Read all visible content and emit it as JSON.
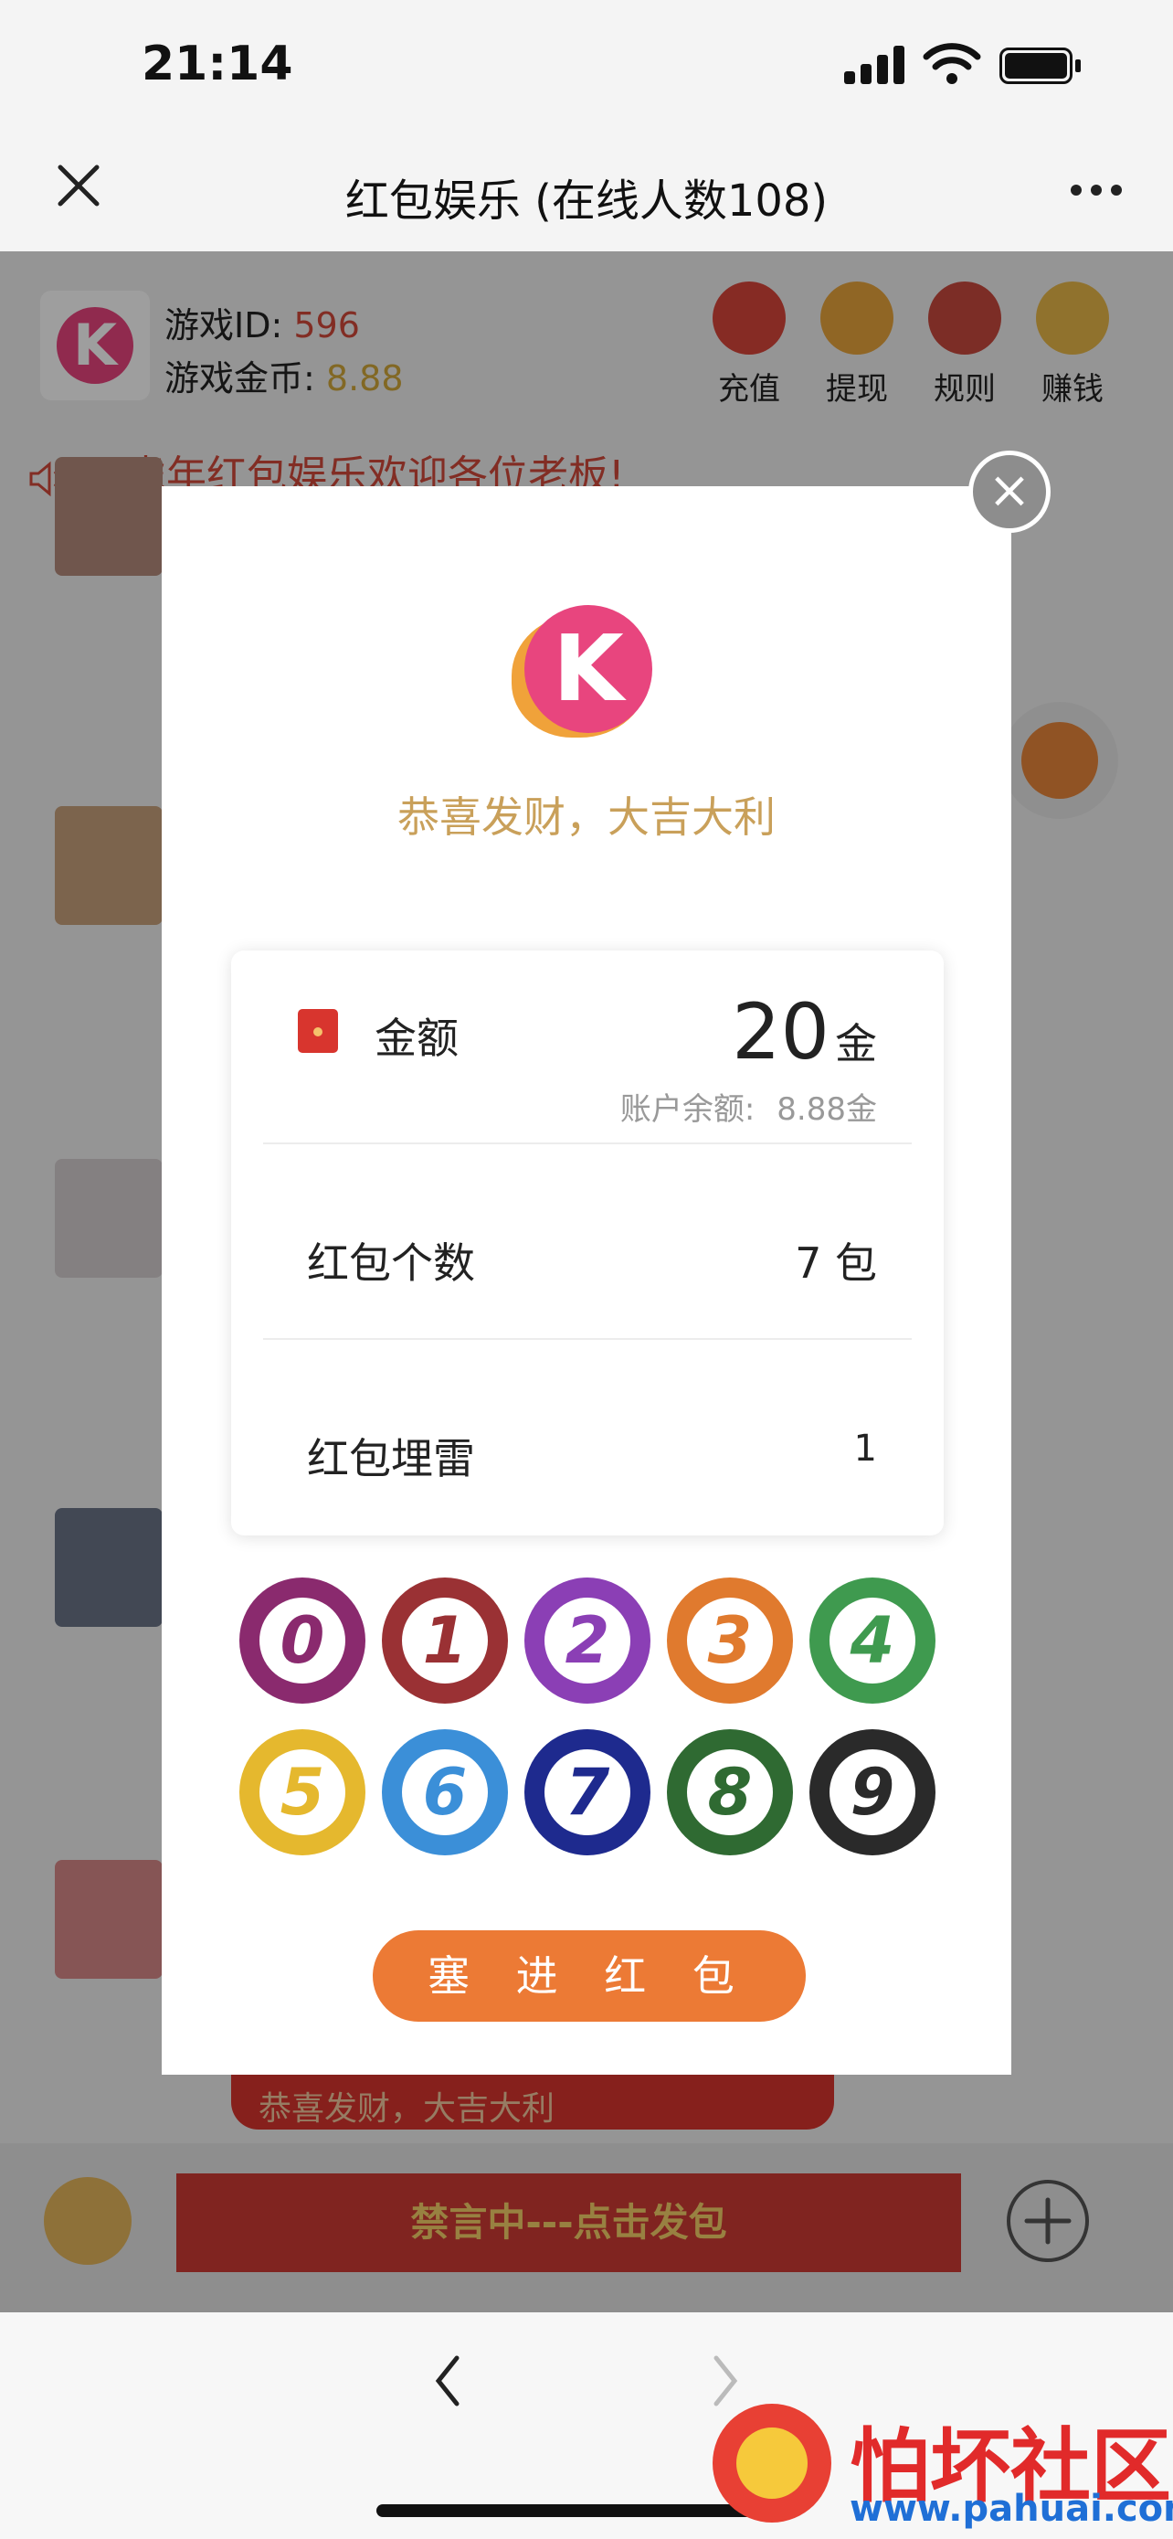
{
  "status": {
    "time": "21:14"
  },
  "nav": {
    "title": "红包娱乐 (在线人数108)",
    "close": "×",
    "more": "•••"
  },
  "header": {
    "game_id_label": "游戏ID: ",
    "game_id": "596",
    "coins_label": "游戏金币: ",
    "coins": "8.88",
    "tools": [
      {
        "label": "充值",
        "icon": "red-envelope-icon",
        "color": "#d9463a"
      },
      {
        "label": "提现",
        "icon": "fa-tile-icon",
        "color": "#e8a53c"
      },
      {
        "label": "规则",
        "icon": "gong-icon",
        "color": "#c84a3e"
      },
      {
        "label": "赚钱",
        "icon": "gold-ingot-icon",
        "color": "#e9b84a"
      }
    ]
  },
  "marquee": {
    "text": "虎年红包娱乐欢迎各位老板!",
    "icon": "speaker-icon"
  },
  "modal": {
    "tagline": "恭喜发财，大吉大利",
    "amount_label": "金额",
    "amount_value": "20",
    "amount_unit": "金",
    "balance_label": "账户余额:",
    "balance_value": "8.88金",
    "count_label": "红包个数",
    "count_value": "7 包",
    "mine_label": "红包埋雷",
    "mine_value": "1",
    "chips": [
      {
        "n": "0",
        "color": "#8a2a6e"
      },
      {
        "n": "1",
        "color": "#9a3134"
      },
      {
        "n": "2",
        "color": "#8b3fb5"
      },
      {
        "n": "3",
        "color": "#e07a2e"
      },
      {
        "n": "4",
        "color": "#3f9a4f"
      },
      {
        "n": "5",
        "color": "#e5b82e"
      },
      {
        "n": "6",
        "color": "#3b8fd8"
      },
      {
        "n": "7",
        "color": "#1e2a8e"
      },
      {
        "n": "8",
        "color": "#2f6a32"
      },
      {
        "n": "9",
        "color": "#2a2a2a"
      }
    ],
    "submit": "塞 进 红 包"
  },
  "chat_behind": {
    "envelope_text": "恭喜发财，大吉大利"
  },
  "bottom": {
    "mute_button": "禁言中---点击发包",
    "plus": "+"
  },
  "browser": {
    "back": "‹",
    "forward": "›"
  },
  "watermark": {
    "brand": "怕坏社区",
    "url": "www.pahuai.com"
  }
}
